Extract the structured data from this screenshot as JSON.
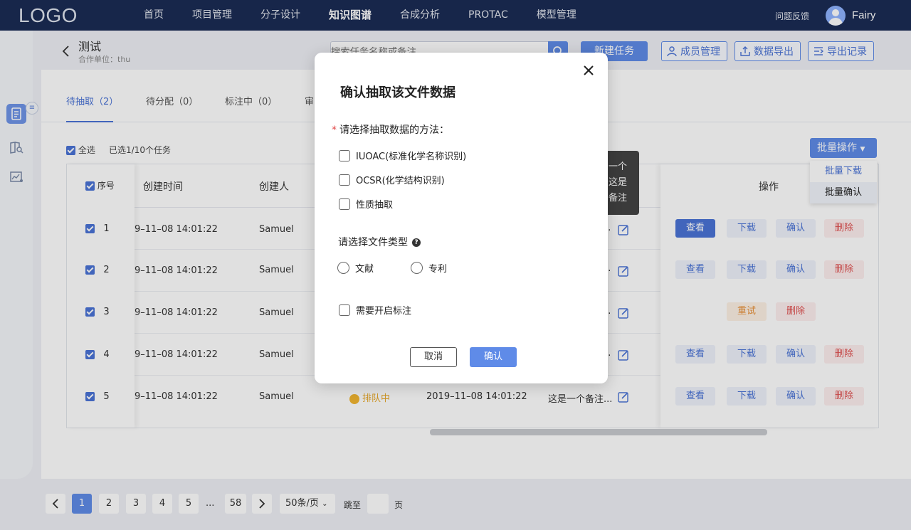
{
  "app": {
    "logo": "LOGO"
  },
  "nav": {
    "items": [
      {
        "label": "首页"
      },
      {
        "label": "项目管理"
      },
      {
        "label": "分子设计"
      },
      {
        "label": "知识图谱"
      },
      {
        "label": "合成分析"
      },
      {
        "label": "PROTAC"
      },
      {
        "label": "模型管理"
      }
    ],
    "active_index": 3,
    "feedback": "问题反馈",
    "username": "Fairy"
  },
  "header": {
    "title": "测试",
    "subtitle": "合作单位：thu",
    "search_placeholder": "搜索任务名称或备注",
    "new_task": "新建任务",
    "member_mgmt": "成员管理",
    "data_export": "数据导出",
    "export_log": "导出记录"
  },
  "tabs": [
    {
      "label": "待抽取（2）"
    },
    {
      "label": "待分配（0）"
    },
    {
      "label": "标注中（0）"
    },
    {
      "label": "审"
    }
  ],
  "selection": {
    "select_all": "全选",
    "count": "已选1/10个任务"
  },
  "batch": {
    "label": "批量操作",
    "menu": [
      "批量下载",
      "批量确认"
    ]
  },
  "tooltip": {
    "lines": [
      "一个",
      "这是",
      "备注"
    ]
  },
  "table": {
    "columns": {
      "index": "序号",
      "created": "创建时间",
      "creator": "创建人",
      "ops": "操作"
    },
    "rows": [
      {
        "index": "1",
        "created": "9–11–08 14:01:22",
        "creator": "Samuel",
        "note": "...",
        "ops": [
          "查看",
          "下载",
          "确认",
          "删除"
        ]
      },
      {
        "index": "2",
        "created": "9–11–08 14:01:22",
        "creator": "Samuel",
        "note": "...",
        "ops": [
          "查看",
          "下载",
          "确认",
          "删除"
        ]
      },
      {
        "index": "3",
        "created": "9–11–08 14:01:22",
        "creator": "Samuel",
        "note": "...",
        "ops": [
          "重试",
          "删除"
        ]
      },
      {
        "index": "4",
        "created": "9–11–08 14:01:22",
        "creator": "Samuel",
        "note": "...",
        "ops": [
          "查看",
          "下载",
          "确认",
          "删除"
        ]
      },
      {
        "index": "5",
        "created": "9–11–08 14:01:22",
        "creator": "Samuel",
        "status": "排队中",
        "time2": "2019–11–08 14:01:22",
        "note": "这是一个备注...",
        "ops": [
          "查看",
          "下载",
          "确认",
          "删除"
        ]
      }
    ]
  },
  "pagination": {
    "pages": [
      "1",
      "2",
      "3",
      "4",
      "5"
    ],
    "ellipsis": "...",
    "last": "58",
    "page_size": "50条/页",
    "jump_label": "跳至",
    "page_label": "页"
  },
  "modal": {
    "title": "确认抽取该文件数据",
    "method_label": "请选择抽取数据的方法：",
    "methods": [
      "IUOAC(标准化学名称识别)",
      "OCSR(化学结构识别)",
      "性质抽取"
    ],
    "filetype_label": "请选择文件类型",
    "filetypes": [
      "文献",
      "专利"
    ],
    "annotate": "需要开启标注",
    "cancel": "取消",
    "confirm": "确认"
  },
  "colors": {
    "nav_bg": "#1b2c55",
    "primary": "#5f8be8",
    "danger": "#e05050",
    "warning": "#e8913a"
  }
}
